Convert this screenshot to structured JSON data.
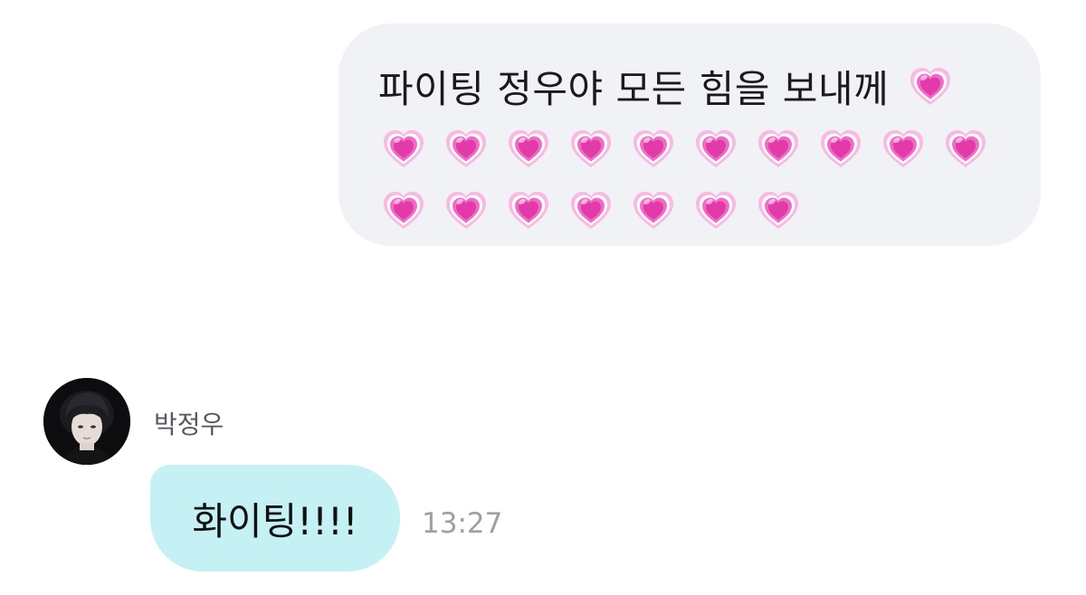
{
  "sent_message": {
    "text": "파이팅 정우야 모든 힘을 보내께",
    "trailing_emoji": "growing-heart-emoji",
    "emoji_rows": [
      [
        "growing-heart-emoji",
        "growing-heart-emoji",
        "growing-heart-emoji",
        "growing-heart-emoji",
        "growing-heart-emoji",
        "growing-heart-emoji",
        "growing-heart-emoji",
        "growing-heart-emoji",
        "growing-heart-emoji",
        "growing-heart-emoji"
      ],
      [
        "growing-heart-emoji",
        "growing-heart-emoji",
        "growing-heart-emoji",
        "growing-heart-emoji",
        "growing-heart-emoji",
        "growing-heart-emoji",
        "growing-heart-emoji"
      ]
    ]
  },
  "received_message": {
    "sender_name": "박정우",
    "text": "화이팅!!!!",
    "time": "13:27"
  },
  "colors": {
    "sent_bubble": "#f1f2f6",
    "received_bubble": "#c5f1f4",
    "heart_outer": "#f9b9e3",
    "heart_mid": "#f06cc4",
    "heart_inner": "#e23aa8",
    "timestamp": "#9aa0a6"
  }
}
